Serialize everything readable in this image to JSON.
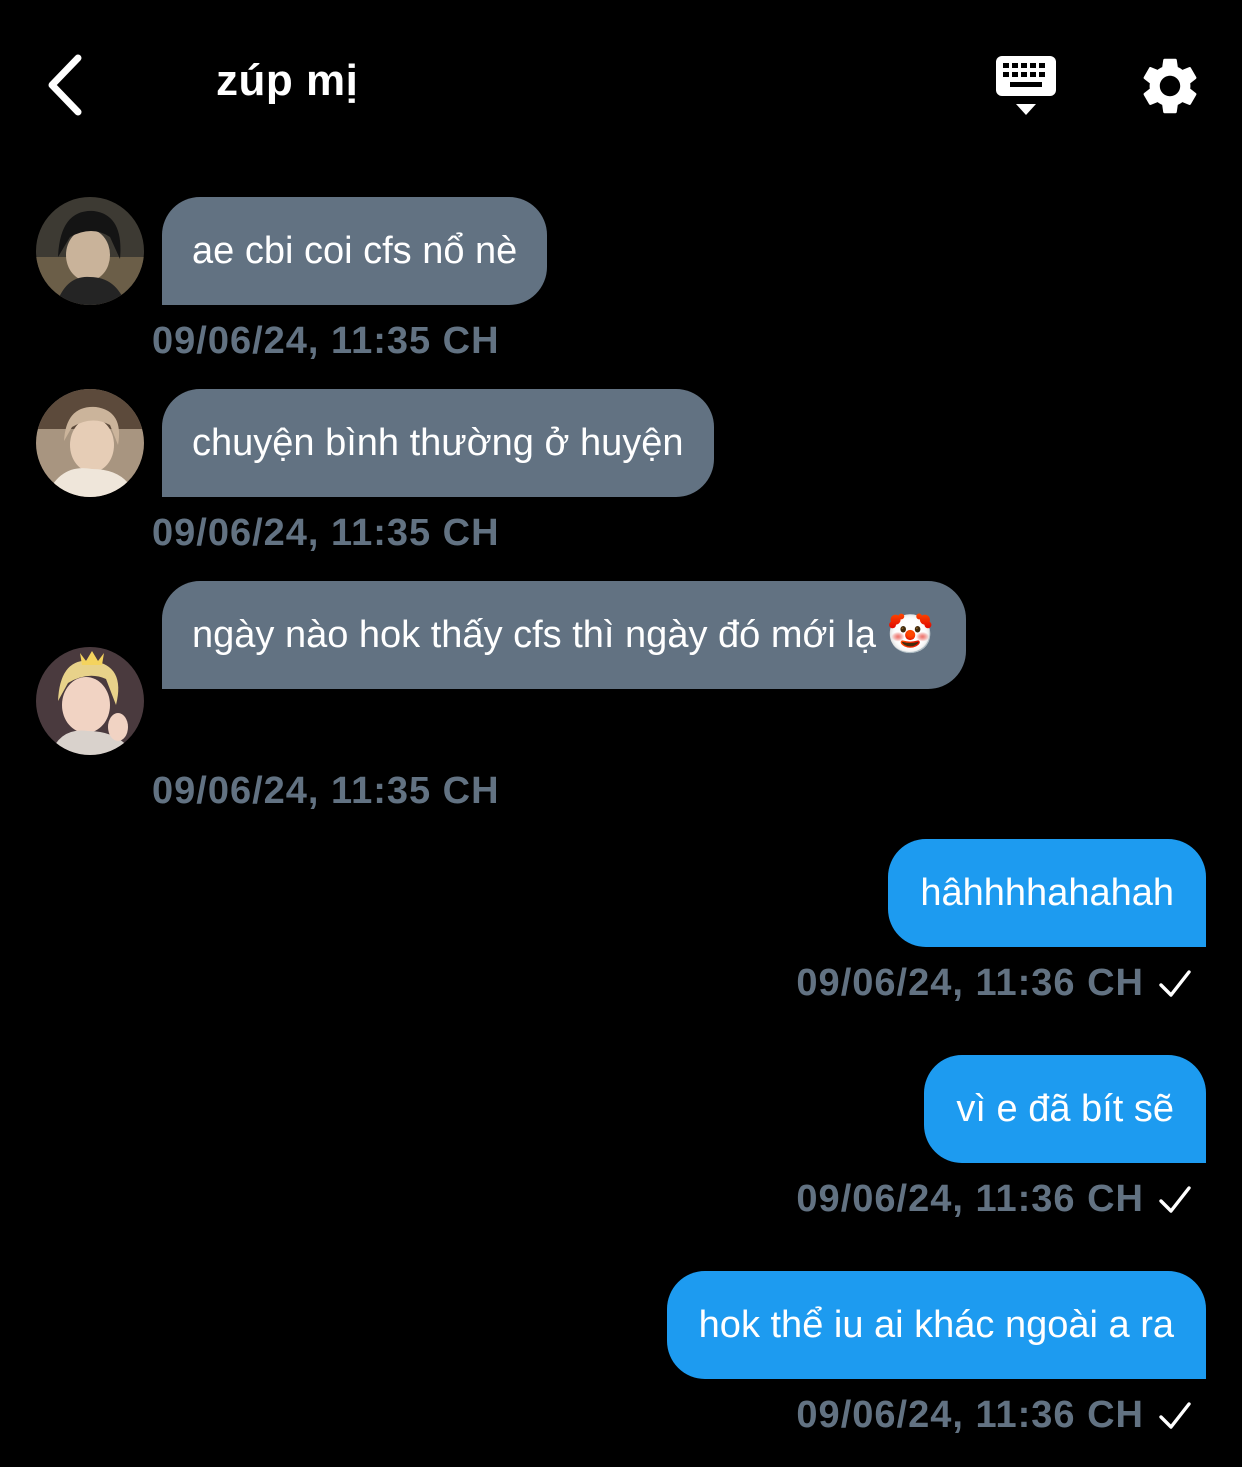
{
  "header": {
    "title": "zúp mị"
  },
  "messages": [
    {
      "direction": "in",
      "text": "ae cbi coi cfs nổ nè",
      "timestamp": "09/06/24, 11:35 CH"
    },
    {
      "direction": "in",
      "text": "chuyện bình thường ở huyện",
      "timestamp": "09/06/24, 11:35 CH"
    },
    {
      "direction": "in",
      "text": "ngày nào hok thấy cfs thì ngày đó mới lạ 🤡",
      "timestamp": "09/06/24, 11:35 CH"
    },
    {
      "direction": "out",
      "text": "hâhhhhahahah",
      "timestamp": "09/06/24, 11:36 CH",
      "status_icon": "checkmark-icon"
    },
    {
      "direction": "out",
      "text": "vì e đã bít sẽ",
      "timestamp": "09/06/24, 11:36 CH",
      "status_icon": "checkmark-icon"
    },
    {
      "direction": "out",
      "text": "hok thể iu ai khác ngoài a ra",
      "timestamp": "09/06/24, 11:36 CH",
      "status_icon": "checkmark-icon"
    }
  ],
  "colors": {
    "background": "#000000",
    "incoming_bubble": "#627282",
    "outgoing_bubble": "#1d9bf0",
    "timestamp": "#627282"
  }
}
